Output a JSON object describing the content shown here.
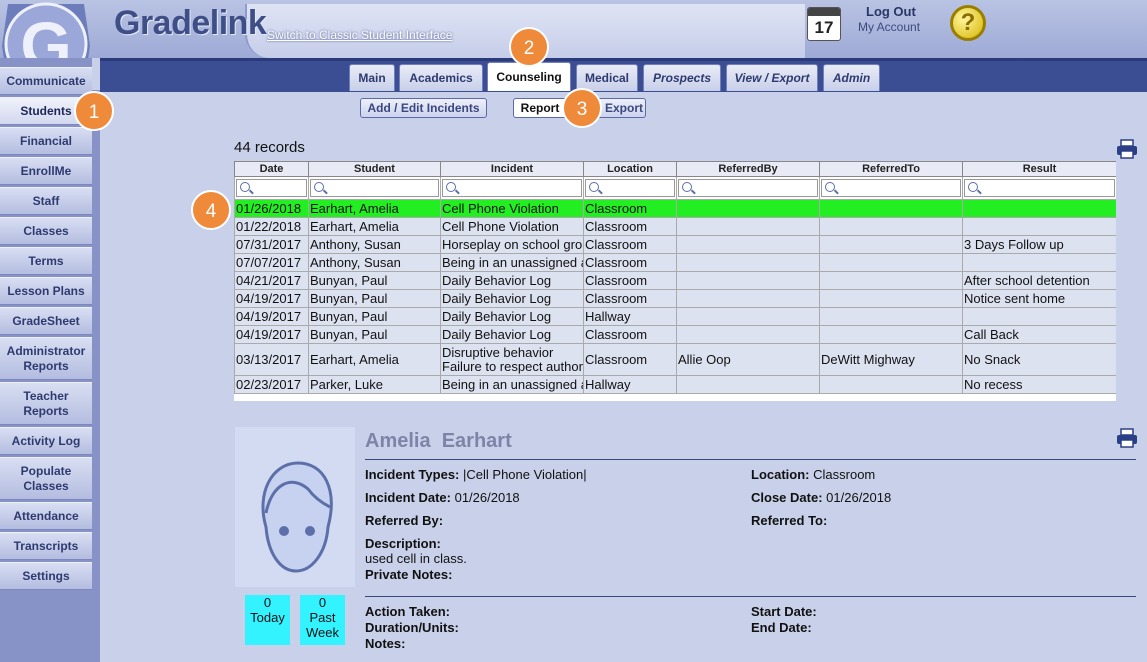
{
  "header": {
    "app_title": "Gradelink",
    "classic_link": "Switch to Classic Student Interface",
    "calendar_day": "17",
    "logout": "Log Out",
    "my_account": "My Account",
    "help": "?"
  },
  "sidebar": {
    "items": [
      {
        "label": "Communicate"
      },
      {
        "label": "Students"
      },
      {
        "label": "Financial"
      },
      {
        "label": "EnrollMe"
      },
      {
        "label": "Staff"
      },
      {
        "label": "Classes"
      },
      {
        "label": "Terms"
      },
      {
        "label": "Lesson Plans"
      },
      {
        "label": "GradeSheet"
      },
      {
        "label": "Administrator Reports"
      },
      {
        "label": "Teacher Reports"
      },
      {
        "label": "Activity Log"
      },
      {
        "label": "Populate Classes"
      },
      {
        "label": "Attendance"
      },
      {
        "label": "Transcripts"
      },
      {
        "label": "Settings"
      }
    ]
  },
  "tabs": [
    {
      "label": "Main"
    },
    {
      "label": "Academics"
    },
    {
      "label": "Counseling"
    },
    {
      "label": "Medical"
    },
    {
      "label": "Prospects"
    },
    {
      "label": "View / Export"
    },
    {
      "label": "Admin"
    }
  ],
  "subnav": {
    "add_edit": "Add / Edit Incidents",
    "report": "Report",
    "export": "Export"
  },
  "callouts": [
    "1",
    "2",
    "3",
    "4"
  ],
  "table": {
    "records_label": "44 records",
    "columns": [
      "Date",
      "Student",
      "Incident",
      "Location",
      "ReferredBy",
      "ReferredTo",
      "Result"
    ],
    "rows": [
      {
        "date": "01/26/2018",
        "student": "Earhart, Amelia",
        "incident": "Cell Phone Violation",
        "location": "Classroom",
        "referred_by": "",
        "referred_to": "",
        "result": ""
      },
      {
        "date": "01/22/2018",
        "student": "Earhart, Amelia",
        "incident": "Cell Phone Violation",
        "location": "Classroom",
        "referred_by": "",
        "referred_to": "",
        "result": ""
      },
      {
        "date": "07/31/2017",
        "student": "Anthony, Susan",
        "incident": "Horseplay on school grounds",
        "location": "Classroom",
        "referred_by": "",
        "referred_to": "",
        "result": "3 Days Follow up"
      },
      {
        "date": "07/07/2017",
        "student": "Anthony, Susan",
        "incident": "Being in an unassigned area",
        "location": "Classroom",
        "referred_by": "",
        "referred_to": "",
        "result": ""
      },
      {
        "date": "04/21/2017",
        "student": "Bunyan, Paul",
        "incident": "Daily Behavior Log",
        "location": "Classroom",
        "referred_by": "",
        "referred_to": "",
        "result": "After school detention"
      },
      {
        "date": "04/19/2017",
        "student": "Bunyan, Paul",
        "incident": "Daily Behavior Log",
        "location": "Classroom",
        "referred_by": "",
        "referred_to": "",
        "result": "Notice sent home"
      },
      {
        "date": "04/19/2017",
        "student": "Bunyan, Paul",
        "incident": "Daily Behavior Log",
        "location": "Hallway",
        "referred_by": "",
        "referred_to": "",
        "result": ""
      },
      {
        "date": "04/19/2017",
        "student": "Bunyan, Paul",
        "incident": "Daily Behavior Log",
        "location": "Classroom",
        "referred_by": "",
        "referred_to": "",
        "result": "Call Back"
      },
      {
        "date": "03/13/2017",
        "student": "Earhart, Amelia",
        "incident": "Disruptive behavior",
        "incident2": "Failure to respect authority",
        "location": "Classroom",
        "referred_by": "Allie Oop",
        "referred_to": "DeWitt Mighway",
        "result": "No Snack"
      },
      {
        "date": "02/23/2017",
        "student": "Parker, Luke",
        "incident": "Being in an unassigned area",
        "location": "Hallway",
        "referred_by": "",
        "referred_to": "",
        "result": "No recess"
      }
    ]
  },
  "detail": {
    "first_name": "Amelia",
    "last_name": "Earhart",
    "incident_types_label": "Incident Types:",
    "incident_types": "|Cell Phone Violation|",
    "location_label": "Location:",
    "location": "Classroom",
    "incident_date_label": "Incident Date:",
    "incident_date": "01/26/2018",
    "close_date_label": "Close Date:",
    "close_date": "01/26/2018",
    "referred_by_label": "Referred By:",
    "referred_to_label": "Referred To:",
    "description_label": "Description:",
    "description": "used cell in class.",
    "private_notes_label": "Private Notes:",
    "action_taken_label": "Action Taken:",
    "start_date_label": "Start Date:",
    "duration_label": "Duration/Units:",
    "end_date_label": "End Date:",
    "notes_label": "Notes:",
    "today_count": "0",
    "today_label": "Today",
    "past_week_count": "0",
    "past_week_label_1": "Past",
    "past_week_label_2": "Week"
  },
  "colors": {
    "nav": "#3b4d93",
    "selected_row": "#22ee22",
    "stat_box": "#32f3ff",
    "callout": "#ef8a3a"
  }
}
